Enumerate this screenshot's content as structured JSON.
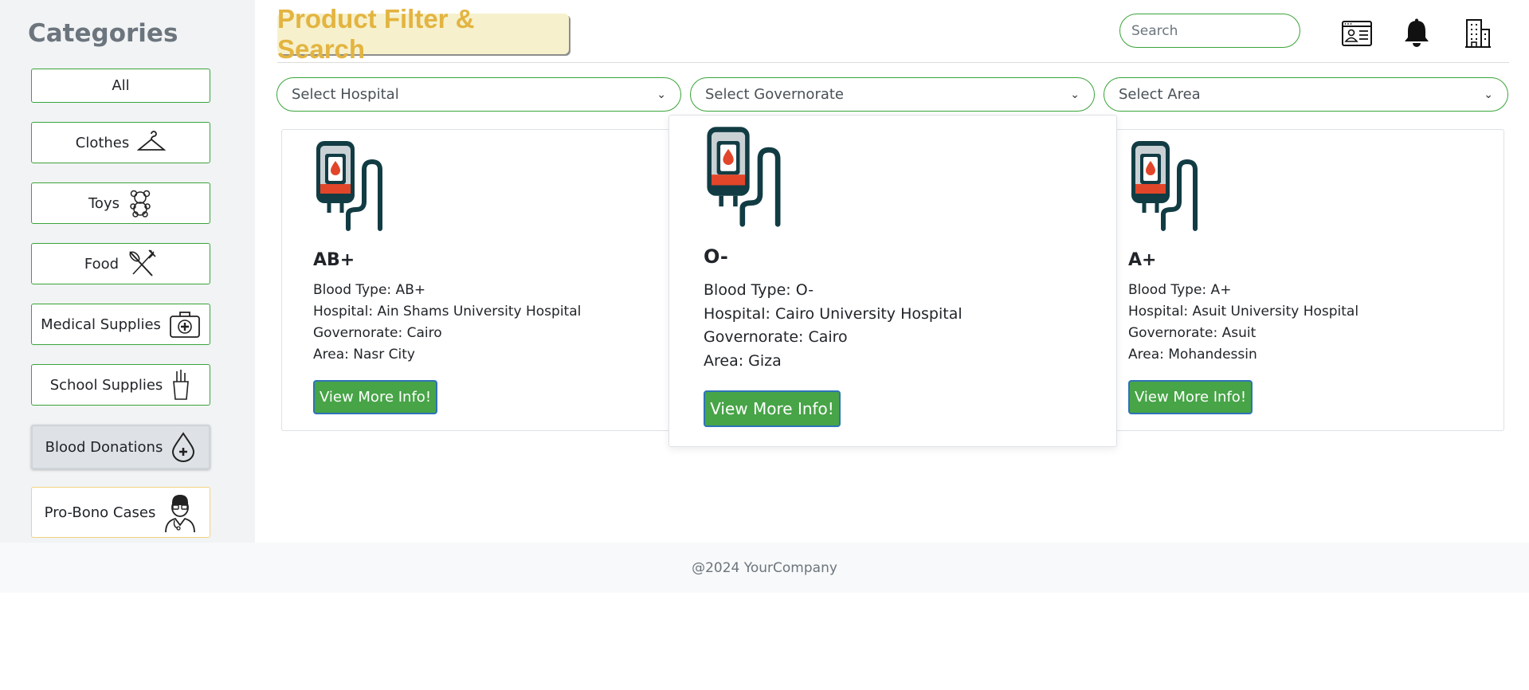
{
  "sidebar": {
    "title": "Categories",
    "items": [
      {
        "label": "All",
        "icon": "none"
      },
      {
        "label": "Clothes",
        "icon": "hanger-icon"
      },
      {
        "label": "Toys",
        "icon": "teddy-bear-icon"
      },
      {
        "label": "Food",
        "icon": "fork-knife-icon"
      },
      {
        "label": "Medical Supplies",
        "icon": "first-aid-kit-icon"
      },
      {
        "label": "School Supplies",
        "icon": "pencil-cup-icon"
      },
      {
        "label": "Blood Donations",
        "icon": "blood-drop-plus-icon",
        "active": true
      },
      {
        "label": "Pro-Bono Cases",
        "icon": "doctor-icon"
      }
    ]
  },
  "header": {
    "brand": "Product Filter & Search",
    "search_placeholder": "Search",
    "icons": [
      "profile-card-icon",
      "bell-icon",
      "building-icon"
    ]
  },
  "filters": {
    "hospital": "Select Hospital",
    "governorate": "Select Governorate",
    "area": "Select Area"
  },
  "cards": [
    {
      "title": "AB+",
      "blood_type": "Blood Type: AB+",
      "hospital": "Hospital: Ain Shams University Hospital",
      "governorate": "Governorate: Cairo",
      "area": "Area: Nasr City",
      "button": "View More Info!"
    },
    {
      "title": "O-",
      "blood_type": "Blood Type: O-",
      "hospital": "Hospital: Cairo University Hospital",
      "governorate": "Governorate: Cairo",
      "area": "Area: Giza",
      "button": "View More Info!"
    },
    {
      "title": "A+",
      "blood_type": "Blood Type: A+",
      "hospital": "Hospital: Asuit University Hospital",
      "governorate": "Governorate: Asuit",
      "area": "Area: Mohandessin",
      "button": "View More Info!"
    }
  ],
  "footer": {
    "text": "@2024 YourCompany"
  },
  "colors": {
    "accent_green": "#3aa43a",
    "button_green": "#47a447",
    "brand_yellow": "#e3b441",
    "blood_red": "#e2462a",
    "icon_dark": "#123c44"
  }
}
